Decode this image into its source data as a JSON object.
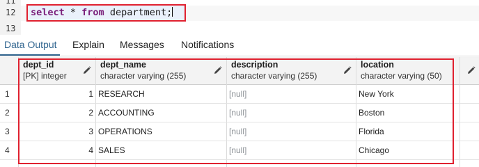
{
  "editor": {
    "line_numbers": [
      "11",
      "12",
      "13"
    ],
    "query": {
      "kw1": "select",
      "star": " * ",
      "kw2": "from",
      "rest": " department;"
    }
  },
  "tabs": [
    {
      "label": "Data Output",
      "active": true
    },
    {
      "label": "Explain",
      "active": false
    },
    {
      "label": "Messages",
      "active": false
    },
    {
      "label": "Notifications",
      "active": false
    }
  ],
  "grid": {
    "columns": [
      {
        "name": "dept_id",
        "type": "[PK] integer"
      },
      {
        "name": "dept_name",
        "type": "character varying (255)"
      },
      {
        "name": "description",
        "type": "character varying (255)"
      },
      {
        "name": "location",
        "type": "character varying (50)"
      }
    ],
    "rows": [
      {
        "num": "1",
        "dept_id": "1",
        "dept_name": "RESEARCH",
        "description": "[null]",
        "location": "New York"
      },
      {
        "num": "2",
        "dept_id": "2",
        "dept_name": "ACCOUNTING",
        "description": "[null]",
        "location": "Boston"
      },
      {
        "num": "3",
        "dept_id": "3",
        "dept_name": "OPERATIONS",
        "description": "[null]",
        "location": "Florida"
      },
      {
        "num": "4",
        "dept_id": "4",
        "dept_name": "SALES",
        "description": "[null]",
        "location": "Chicago"
      }
    ]
  },
  "colors": {
    "highlight_border": "#e0202f",
    "active_tab": "#326690",
    "keyword": "#7a1f7a",
    "null_text": "#8a8f94"
  },
  "icons": [
    "pencil-edit-icon"
  ]
}
